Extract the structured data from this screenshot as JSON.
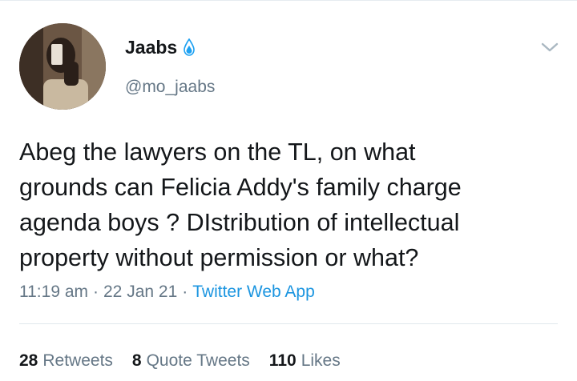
{
  "author": {
    "display_name": "Jaabs",
    "handle": "@mo_jaabs",
    "badge_icon": "water-drop-icon",
    "badge_color": "#1da1f2"
  },
  "menu": {
    "icon": "chevron-down-icon"
  },
  "tweet": {
    "text": "Abeg the lawyers on the TL, on what\ngrounds can Felicia Addy's family charge\nagenda boys ? DIstribution of intellectual\nproperty without permission or what?"
  },
  "meta": {
    "time": "11:19 am",
    "separator": "·",
    "date": "22 Jan 21",
    "source": "Twitter Web App"
  },
  "stats": {
    "retweets_count": "28",
    "retweets_label": "Retweets",
    "quote_count": "8",
    "quote_label": "Quote Tweets",
    "likes_count": "110",
    "likes_label": "Likes"
  },
  "colors": {
    "text_primary": "#14171a",
    "text_secondary": "#657786",
    "link": "#1b95e0",
    "divider": "#e1e8ed"
  }
}
